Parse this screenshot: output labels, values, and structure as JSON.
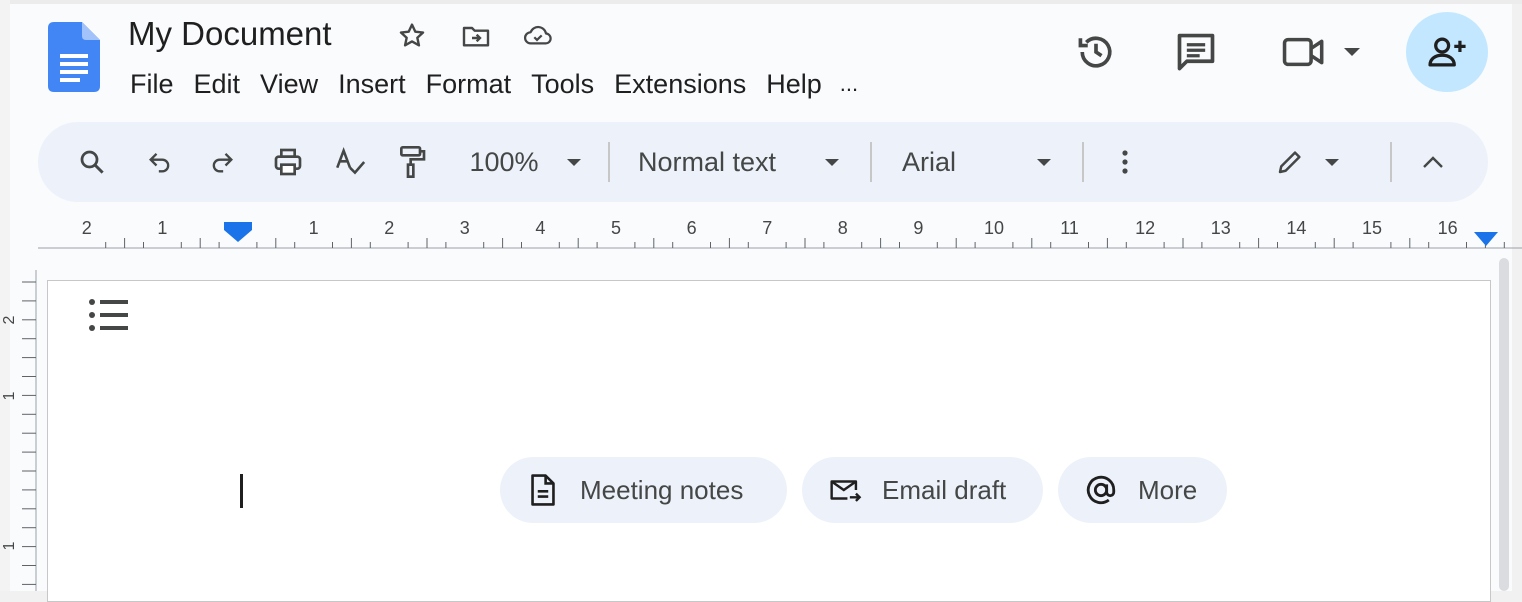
{
  "document": {
    "title": "My Document"
  },
  "menu": {
    "items": [
      "File",
      "Edit",
      "View",
      "Insert",
      "Format",
      "Tools",
      "Extensions",
      "Help"
    ],
    "more_label": "..."
  },
  "toolbar": {
    "zoom": "100%",
    "style": "Normal text",
    "font": "Arial"
  },
  "ruler": {
    "left_labels": [
      "2",
      "1"
    ],
    "labels": [
      "1",
      "2",
      "3",
      "4",
      "5",
      "6",
      "7",
      "8",
      "9",
      "10",
      "11",
      "12",
      "13",
      "14",
      "15",
      "16"
    ],
    "vertical_labels": [
      "2",
      "1",
      "1"
    ]
  },
  "chips": [
    {
      "icon": "document-icon",
      "label": "Meeting notes"
    },
    {
      "icon": "email-draft-icon",
      "label": "Email draft"
    },
    {
      "icon": "at-icon",
      "label": "More"
    }
  ],
  "colors": {
    "accent": "#1a73e8",
    "share_bg": "#c2e7ff",
    "toolbar_bg": "#edf2fa"
  }
}
